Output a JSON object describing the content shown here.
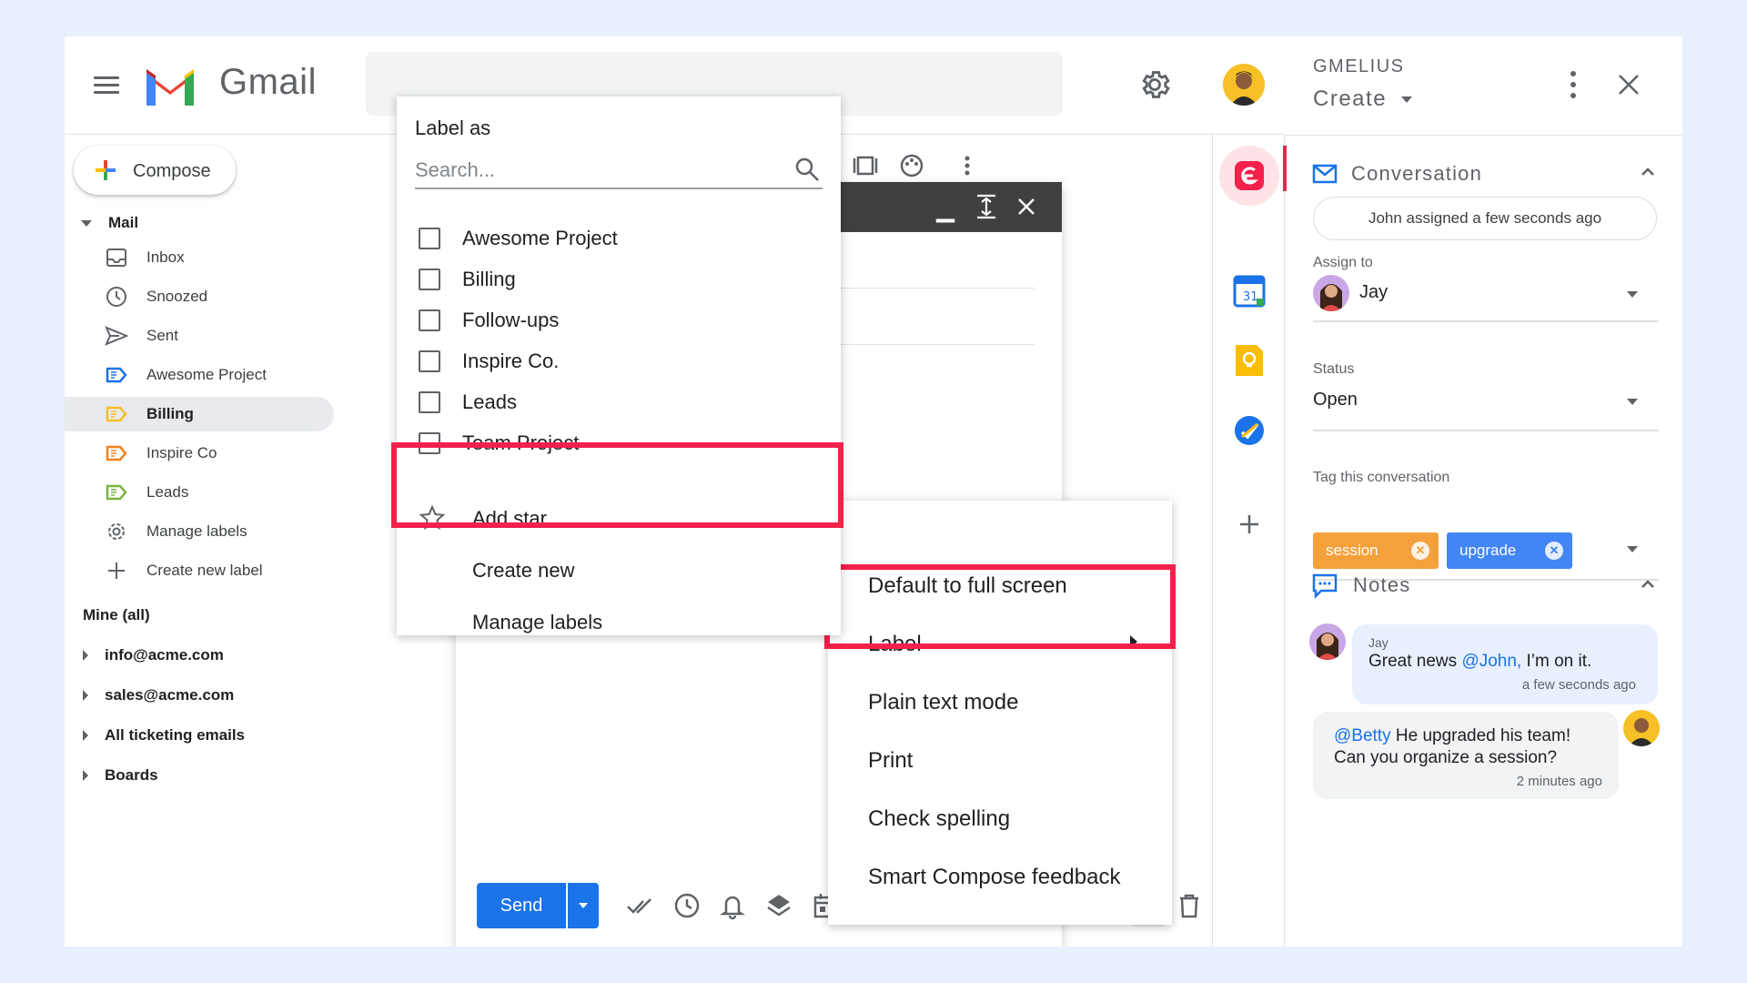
{
  "app": {
    "name": "Gmail"
  },
  "colors": {
    "accent": "#1a73e8",
    "highlight": "#f5204b",
    "tag_orange": "#f4a03c",
    "tag_blue": "#4285f4"
  },
  "compose": {
    "label": "Compose"
  },
  "nav": {
    "mail_section": "Mail",
    "items": [
      {
        "label": "Inbox",
        "icon": "inbox-icon"
      },
      {
        "label": "Snoozed",
        "icon": "clock-icon"
      },
      {
        "label": "Sent",
        "icon": "send-icon"
      },
      {
        "label": "Awesome Project",
        "icon": "label-icon-blue"
      },
      {
        "label": "Billing",
        "icon": "label-icon-yellow",
        "active": true
      },
      {
        "label": "Inspire Co",
        "icon": "label-icon-orange"
      },
      {
        "label": "Leads",
        "icon": "label-icon-green"
      },
      {
        "label": "Manage labels",
        "icon": "gear-icon"
      },
      {
        "label": "Create new label",
        "icon": "plus-icon"
      }
    ],
    "mine_label": "Mine (all)",
    "accounts": [
      "info@acme.com",
      "sales@acme.com",
      "All ticketing emails",
      "Boards"
    ]
  },
  "label_menu": {
    "title": "Label as",
    "search_placeholder": "Search...",
    "labels": [
      "Awesome Project",
      "Billing",
      "Follow-ups",
      "Inspire Co.",
      "Leads",
      "Team Project"
    ],
    "add_star": "Add star",
    "create_new": "Create new",
    "manage_labels": "Manage labels"
  },
  "more_menu": {
    "items": [
      "Default to full screen",
      "Label",
      "Plain text mode",
      "Print",
      "Check spelling",
      "Smart Compose feedback"
    ]
  },
  "compose_window": {
    "send_label": "Send"
  },
  "gmelius": {
    "brand": "GMELIUS",
    "create": "Create",
    "conversation_title": "Conversation",
    "assignment_status": "John assigned a few seconds ago",
    "assign_to_label": "Assign to",
    "assignee": "Jay",
    "status_label": "Status",
    "status_value": "Open",
    "tag_label": "Tag this conversation",
    "tags": [
      "session",
      "upgrade"
    ],
    "notes_title": "Notes",
    "notes": [
      {
        "author": "Jay",
        "pre": "Great news ",
        "mention": "@John,",
        "post": " I’m on it.",
        "time": "a few seconds ago"
      },
      {
        "mention": "@Betty",
        "line1": " He upgraded his team!",
        "line2": "Can you organize a session?",
        "time": "2 minutes ago"
      }
    ]
  }
}
